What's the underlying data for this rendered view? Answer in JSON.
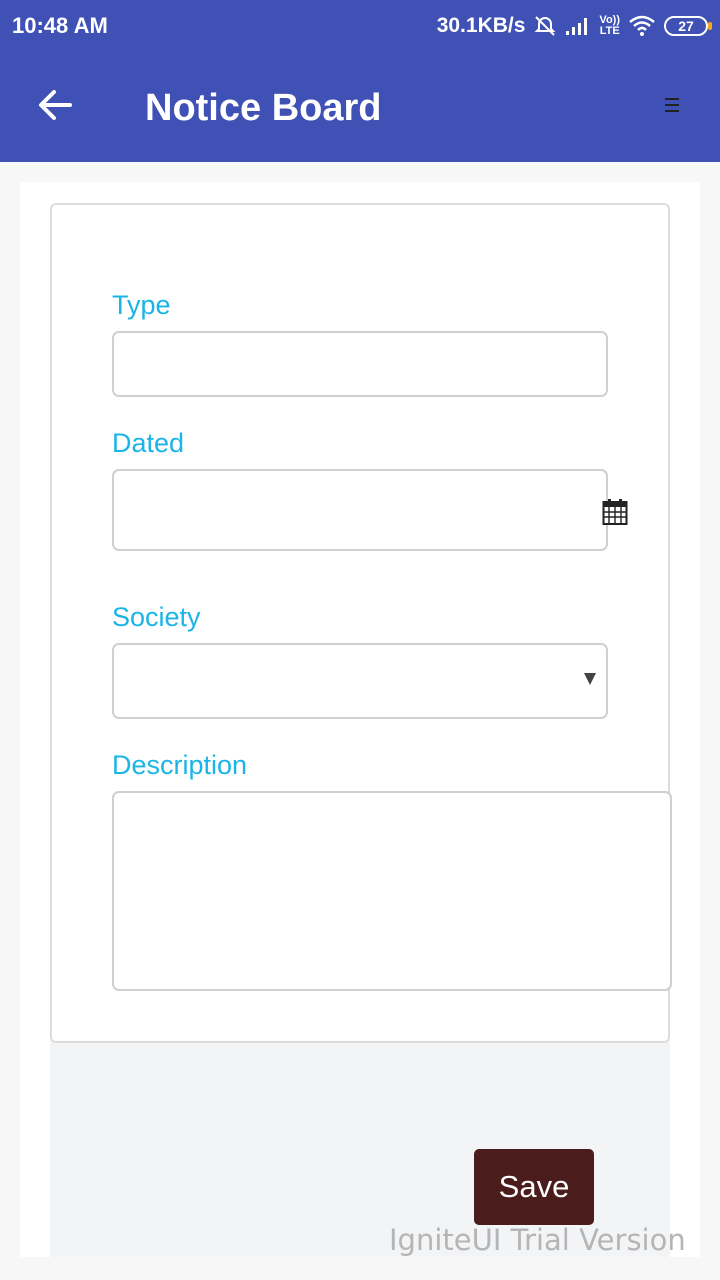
{
  "status_bar": {
    "time": "10:48 AM",
    "network_speed": "30.1KB/s",
    "volte_top": "Vo))",
    "volte_bottom": "LTE",
    "battery": "27"
  },
  "app_bar": {
    "title": "Notice Board",
    "back_icon": "arrow-left-icon",
    "menu_icon": "hamburger-menu-icon",
    "color": "#3f51b5"
  },
  "form": {
    "type_label": "Type",
    "type_value": "",
    "dated_label": "Dated",
    "dated_value": "",
    "society_label": "Society",
    "society_value": "",
    "description_label": "Description",
    "description_value": "",
    "label_color": "#1ab5e6"
  },
  "actions": {
    "save_label": "Save",
    "save_color": "#4a1c1c"
  },
  "watermark": "IgniteUI Trial Version"
}
